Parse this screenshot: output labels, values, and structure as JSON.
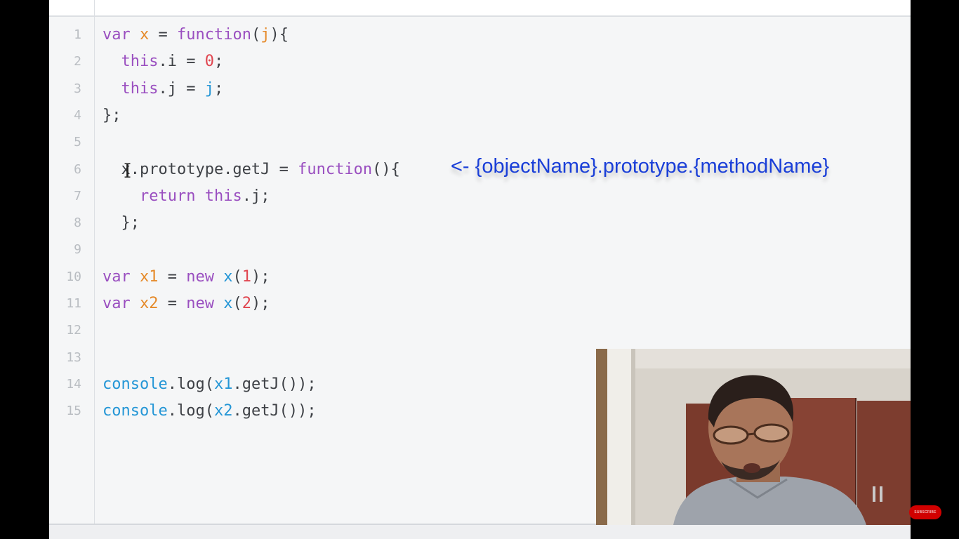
{
  "editor": {
    "lines": [
      {
        "n": "1",
        "tokens": [
          {
            "t": "var",
            "c": "kw"
          },
          {
            "t": " "
          },
          {
            "t": "x",
            "c": "var"
          },
          {
            "t": " = "
          },
          {
            "t": "function",
            "c": "kw"
          },
          {
            "t": "("
          },
          {
            "t": "j",
            "c": "var"
          },
          {
            "t": "){"
          }
        ]
      },
      {
        "n": "2",
        "tokens": [
          {
            "t": "  "
          },
          {
            "t": "this",
            "c": "kw"
          },
          {
            "t": ".i = "
          },
          {
            "t": "0",
            "c": "num"
          },
          {
            "t": ";"
          }
        ]
      },
      {
        "n": "3",
        "tokens": [
          {
            "t": "  "
          },
          {
            "t": "this",
            "c": "kw"
          },
          {
            "t": ".j = "
          },
          {
            "t": "j",
            "c": "fn"
          },
          {
            "t": ";"
          }
        ]
      },
      {
        "n": "4",
        "tokens": [
          {
            "t": "};"
          }
        ]
      },
      {
        "n": "5",
        "tokens": []
      },
      {
        "n": "6",
        "tokens": [
          {
            "t": "  x.prototype.getJ = "
          },
          {
            "t": "function",
            "c": "kw"
          },
          {
            "t": "(){"
          }
        ]
      },
      {
        "n": "7",
        "tokens": [
          {
            "t": "    "
          },
          {
            "t": "return",
            "c": "kw"
          },
          {
            "t": " "
          },
          {
            "t": "this",
            "c": "kw"
          },
          {
            "t": ".j;"
          }
        ]
      },
      {
        "n": "8",
        "tokens": [
          {
            "t": "  };"
          }
        ]
      },
      {
        "n": "9",
        "tokens": []
      },
      {
        "n": "10",
        "tokens": [
          {
            "t": "var",
            "c": "kw"
          },
          {
            "t": " "
          },
          {
            "t": "x1",
            "c": "var"
          },
          {
            "t": " = "
          },
          {
            "t": "new",
            "c": "kw"
          },
          {
            "t": " "
          },
          {
            "t": "x",
            "c": "fn"
          },
          {
            "t": "("
          },
          {
            "t": "1",
            "c": "num"
          },
          {
            "t": ");"
          }
        ]
      },
      {
        "n": "11",
        "tokens": [
          {
            "t": "var",
            "c": "kw"
          },
          {
            "t": " "
          },
          {
            "t": "x2",
            "c": "var"
          },
          {
            "t": " = "
          },
          {
            "t": "new",
            "c": "kw"
          },
          {
            "t": " "
          },
          {
            "t": "x",
            "c": "fn"
          },
          {
            "t": "("
          },
          {
            "t": "2",
            "c": "num"
          },
          {
            "t": ");"
          }
        ]
      },
      {
        "n": "12",
        "tokens": []
      },
      {
        "n": "13",
        "tokens": []
      },
      {
        "n": "14",
        "tokens": [
          {
            "t": "console",
            "c": "fn"
          },
          {
            "t": ".log("
          },
          {
            "t": "x1",
            "c": "fn"
          },
          {
            "t": ".getJ());"
          }
        ]
      },
      {
        "n": "15",
        "tokens": [
          {
            "t": "console",
            "c": "fn"
          },
          {
            "t": ".log("
          },
          {
            "t": "x2",
            "c": "fn"
          },
          {
            "t": ".getJ());"
          }
        ]
      }
    ],
    "cursor_glyph": "I"
  },
  "annotation": {
    "text": "<- {objectName}.prototype.{methodName}"
  },
  "webcam": {
    "icon": "presenter-webcam"
  },
  "badge": {
    "text": "SUBSCRIBE"
  },
  "colors": {
    "keyword": "#9a4fc0",
    "variable": "#e58a2a",
    "identifier": "#2496d6",
    "number": "#e0454f",
    "annotation": "#1a3fd8",
    "editor_bg": "#f5f6f7"
  }
}
